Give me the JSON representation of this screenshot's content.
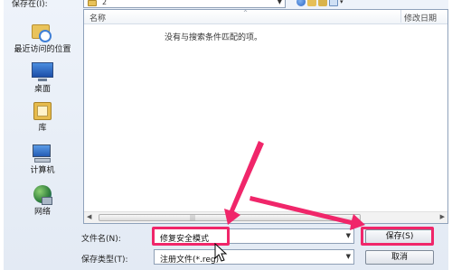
{
  "save_in": {
    "label": "保存在(I):",
    "folder": "2"
  },
  "toolbar": {
    "icons": [
      "back-icon",
      "up-folder-icon",
      "new-folder-icon",
      "view-menu-icon",
      "chevron-down-icon"
    ]
  },
  "sidebar": {
    "items": [
      {
        "label": "最近访问的位置",
        "icon": "recent-places-icon"
      },
      {
        "label": "桌面",
        "icon": "desktop-icon"
      },
      {
        "label": "库",
        "icon": "library-icon"
      },
      {
        "label": "计算机",
        "icon": "computer-icon"
      },
      {
        "label": "网络",
        "icon": "network-icon"
      }
    ]
  },
  "file_list": {
    "columns": [
      "名称",
      "修改日期"
    ],
    "empty_message": "没有与搜索条件匹配的项。"
  },
  "filename": {
    "label": "文件名(N):",
    "value": "修复安全模式"
  },
  "filetype": {
    "label": "保存类型(T):",
    "value": "注册文件(*.reg)"
  },
  "buttons": {
    "save": "保存(S)",
    "cancel": "取消"
  },
  "annotations": {
    "highlight_color": "#f0266a"
  }
}
